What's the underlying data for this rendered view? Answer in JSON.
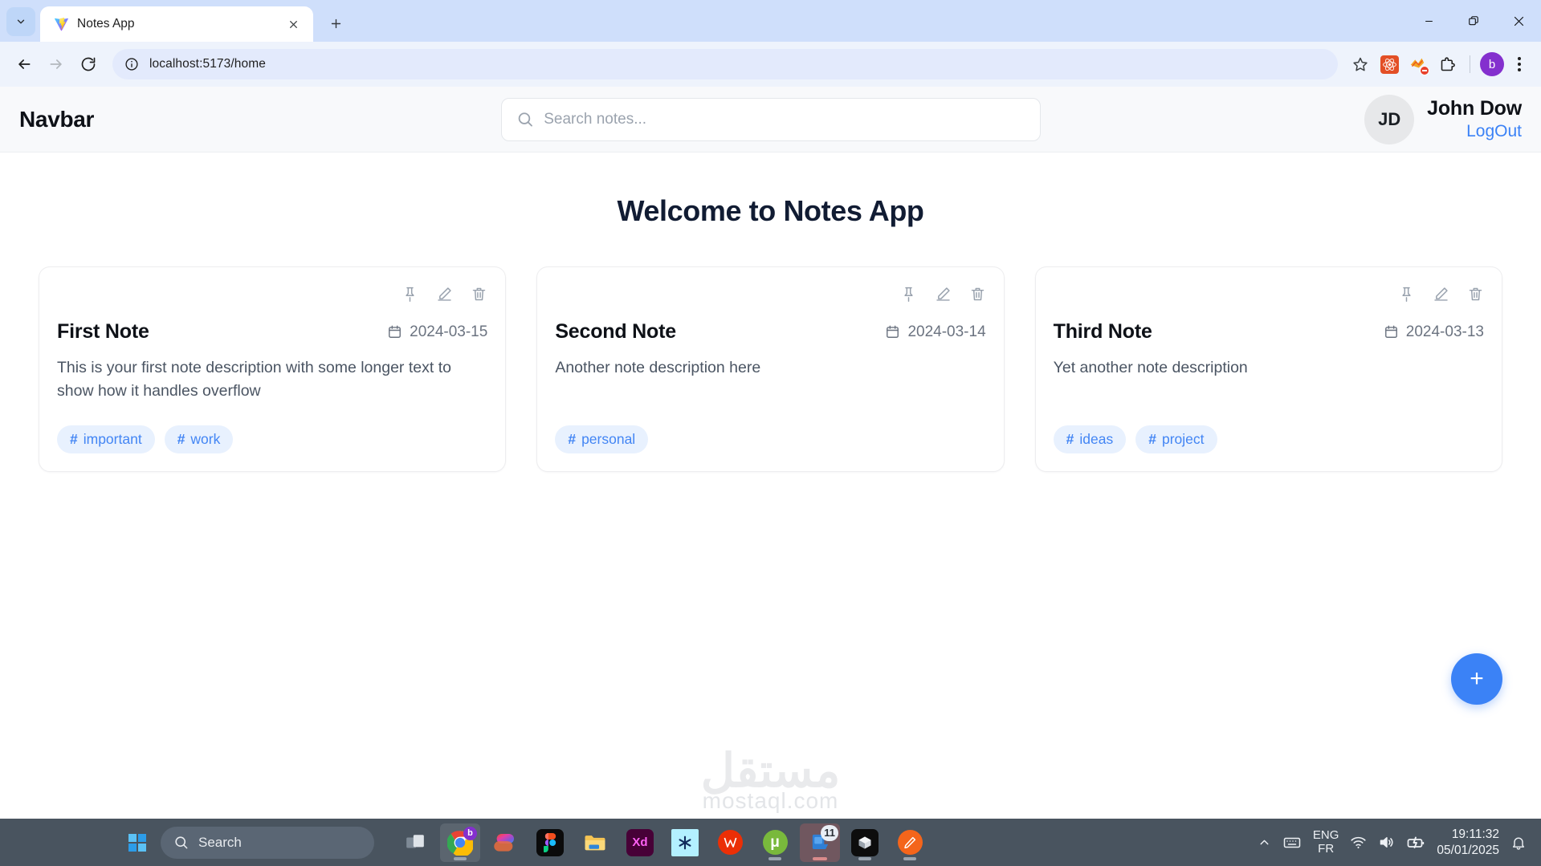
{
  "browser": {
    "tab": {
      "title": "Notes App",
      "favicon_icon": "vite-logo-icon",
      "close_icon": "close-icon"
    },
    "tab_list_icon": "chevron-down-icon",
    "new_tab_icon": "plus-icon",
    "new_tab_label": "+",
    "window_controls": {
      "minimize": "minimize-icon",
      "maximize": "restore-icon",
      "close": "close-icon"
    },
    "nav": {
      "back": "back-arrow-icon",
      "forward": "forward-arrow-icon",
      "reload": "reload-icon"
    },
    "omnibox": {
      "info_icon": "site-info-icon",
      "url": "localhost:5173/home"
    },
    "actions": {
      "bookmark_icon": "star-icon",
      "ext_react_icon": "react-devtools-icon",
      "ext_blocked_icon": "extension-blocked-icon",
      "extensions_icon": "puzzle-piece-icon",
      "profile_initial": "b",
      "menu_icon": "kebab-menu-icon"
    }
  },
  "app": {
    "navbar": {
      "brand": "Navbar",
      "search": {
        "placeholder": "Search notes...",
        "value": "",
        "icon": "search-icon"
      },
      "user": {
        "initials": "JD",
        "name": "John Dow",
        "logout_label": "LogOut"
      }
    },
    "page_title": "Welcome to Notes App",
    "note_actions": {
      "pin": "pin-icon",
      "edit": "edit-pencil-icon",
      "delete": "trash-icon"
    },
    "date_icon": "calendar-icon",
    "notes": [
      {
        "title": "First Note",
        "date": "2024-03-15",
        "description": "This is your first note description with some longer text to show how it handles overflow",
        "tags": [
          "important",
          "work"
        ]
      },
      {
        "title": "Second Note",
        "date": "2024-03-14",
        "description": "Another note description here",
        "tags": [
          "personal"
        ]
      },
      {
        "title": "Third Note",
        "date": "2024-03-13",
        "description": "Yet another note description",
        "tags": [
          "ideas",
          "project"
        ]
      }
    ],
    "fab": {
      "label": "+",
      "icon": "plus-icon"
    },
    "colors": {
      "accent": "#3b82f6",
      "tag_bg": "#e8f1fe",
      "tag_text": "#4285f4",
      "navbar_bg": "#f8f9fb",
      "title_text": "#111c33"
    }
  },
  "watermark": {
    "arabic": "مستقل",
    "latin": "mostaql.com"
  },
  "taskbar": {
    "start_icon": "windows-start-icon",
    "search": {
      "placeholder": "Search",
      "icon": "search-icon"
    },
    "apps": [
      {
        "name": "task-view",
        "icon": "task-view-icon"
      },
      {
        "name": "google-chrome",
        "icon": "chrome-icon",
        "badge": "b"
      },
      {
        "name": "microsoft-365",
        "icon": "microsoft-365-icon"
      },
      {
        "name": "figma",
        "icon": "figma-icon"
      },
      {
        "name": "file-explorer",
        "icon": "file-explorer-icon"
      },
      {
        "name": "adobe-xd",
        "icon": "adobe-xd-icon",
        "label": "Xd"
      },
      {
        "name": "snowflake-app",
        "icon": "asterisk-icon"
      },
      {
        "name": "wps-office",
        "icon": "wps-office-icon",
        "label": "W"
      },
      {
        "name": "utorrent",
        "icon": "utorrent-icon",
        "label": "μ"
      },
      {
        "name": "messaging-app",
        "icon": "messaging-icon",
        "count": "11"
      },
      {
        "name": "3d-viewer",
        "icon": "cube-icon"
      },
      {
        "name": "paint-tool",
        "icon": "pen-icon"
      }
    ],
    "tray": {
      "overflow_icon": "chevron-up-icon",
      "keyboard_icon": "keyboard-icon",
      "lang_primary": "ENG",
      "lang_secondary": "FR",
      "wifi_icon": "wifi-icon",
      "volume_icon": "speaker-icon",
      "battery_icon": "battery-charging-icon",
      "time": "19:11:32",
      "date": "05/01/2025",
      "notification_icon": "bell-icon"
    }
  }
}
